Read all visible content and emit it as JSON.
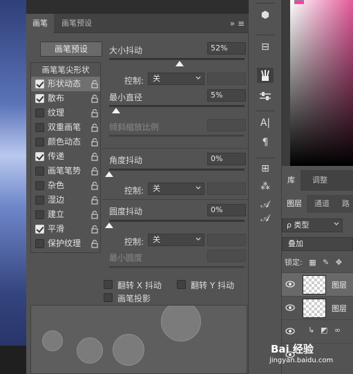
{
  "brush_panel": {
    "tabs": [
      {
        "label": "画笔",
        "active": true
      },
      {
        "label": "画笔预设",
        "active": false
      }
    ],
    "menu_icons": "»  ≡",
    "preset_button": "画笔预设",
    "list_header": "画笔笔尖形状",
    "items": [
      {
        "label": "形状动态",
        "checked": true,
        "selected": true
      },
      {
        "label": "散布",
        "checked": true
      },
      {
        "label": "纹理",
        "checked": false
      },
      {
        "label": "双重画笔",
        "checked": false
      },
      {
        "label": "颜色动态",
        "checked": false
      },
      {
        "label": "传递",
        "checked": true
      },
      {
        "label": "画笔笔势",
        "checked": false
      },
      {
        "label": "杂色",
        "checked": false
      },
      {
        "label": "湿边",
        "checked": false
      },
      {
        "label": "建立",
        "checked": false
      },
      {
        "label": "平滑",
        "checked": true
      },
      {
        "label": "保护纹理",
        "checked": false
      }
    ],
    "size_jitter": {
      "label": "大小抖动",
      "value": "52%",
      "level": 0.52
    },
    "control1": {
      "label": "控制:",
      "value": "关"
    },
    "min_diameter": {
      "label": "最小直径",
      "value": "5%",
      "level": 0.05
    },
    "tilt_scale": {
      "label": "倾斜缩放比例"
    },
    "angle_jitter": {
      "label": "角度抖动",
      "value": "0%",
      "level": 0.0
    },
    "control2": {
      "label": "控制:",
      "value": "关"
    },
    "roundness_jitter": {
      "label": "圆度抖动",
      "value": "0%",
      "level": 0.0
    },
    "control3": {
      "label": "控制:",
      "value": "关"
    },
    "min_roundness": {
      "label": "最小圆度"
    },
    "flip_x": {
      "label": "翻转 X 抖动",
      "checked": false
    },
    "flip_y": {
      "label": "翻转 Y 抖动",
      "checked": false
    },
    "brush_projection": {
      "label": "画笔投影",
      "checked": false
    }
  },
  "tools": {
    "glyphs": [
      "⬢",
      "⊟",
      "⬚",
      "✏",
      "⇌",
      "A|",
      "¶",
      "⊞",
      "⁂",
      "𝒜"
    ],
    "type_label": "A|",
    "para_label": "¶",
    "italic_label": "𝒜"
  },
  "color": {
    "foreground": "#ff3eb0"
  },
  "layers_panel": {
    "top_tabs": [
      {
        "label": "库",
        "active": true
      },
      {
        "label": "调整",
        "active": false
      }
    ],
    "tabs": [
      {
        "label": "图层",
        "active": true
      },
      {
        "label": "通道",
        "active": false
      },
      {
        "label": "路",
        "active": false
      }
    ],
    "filter": "ρ 类型",
    "blend_mode": "叠加",
    "lock_label": "锁定:",
    "layers": [
      {
        "name": "图层",
        "selected": true
      },
      {
        "name": "图层",
        "selected": false
      }
    ]
  },
  "watermark": {
    "brand": "Bai 经验",
    "url": "jingyan.baidu.com"
  }
}
